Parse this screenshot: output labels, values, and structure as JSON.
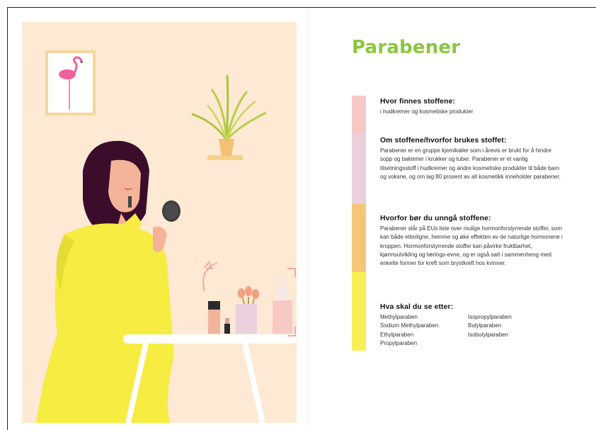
{
  "title": "Parabener",
  "colors": {
    "title": "#8cc63f",
    "bar_1": "#f7c9c6",
    "bar_2": "#ead1dd",
    "bar_3": "#f5c679",
    "bar_4": "#f9ef55",
    "background_wall": "#fde9d4",
    "dress": "#f6ec42",
    "hair": "#3b0d2a"
  },
  "sections": [
    {
      "heading": "Hvor finnes stoffene:",
      "text": "i hudkremer og kosmetiske produkter"
    },
    {
      "heading": "Om stoffene/hvorfor brukes stoffet:",
      "text": "Parabener er en gruppe kjemikalier som i årevis er brukt for å hindre sopp og bakterier i krukker og tuber. Parabener er et vanlig tilsetningsstoff i hudkremer og andre kosmetiske produkter til både barn og voksne, og om lag 80 prosent av all kosmetikk inneholder parabener."
    },
    {
      "heading": "Hvorfor bør du unngå stoffene:",
      "text": "Parabener står på EUs liste over mulige hormonforstyrrende stoffer, som kan både etterligne, hemme og øke effekten av de naturlige hormonene i kroppen. Hormonforstyrrende stoffer kan påvirke fruktbarhet, kjønnsutvikling og lærings-evne, og er også satt i sammenheng med enkelte former for kreft som brystkreft hos kvinner."
    },
    {
      "heading": "Hva skal du se etter:",
      "list_col_1": [
        "Methylparaben",
        "Sodium Methylparaben",
        "Ethylparaben",
        "Propylparaben"
      ],
      "list_col_2": [
        "Isopropylparaben",
        "Butylparaben",
        "Isobutylparaben"
      ]
    }
  ],
  "illustration": {
    "icons": [
      "flamingo-picture-icon",
      "potted-plant-icon",
      "woman-applying-lipstick-icon",
      "hand-mirror-icon",
      "makeup-brushes-icon",
      "lotion-bottle-icon",
      "foundation-bottle-icon",
      "lipstick-icon",
      "table-icon"
    ]
  }
}
